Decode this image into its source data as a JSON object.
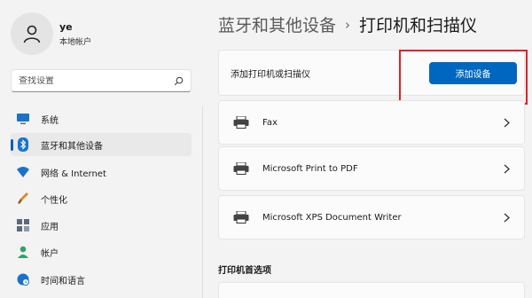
{
  "user": {
    "name": "ye",
    "account_type": "本地帐户"
  },
  "search": {
    "placeholder": "查找设置"
  },
  "sidebar": {
    "items": [
      {
        "label": "系统",
        "icon": "monitor-icon"
      },
      {
        "label": "蓝牙和其他设备",
        "icon": "bluetooth-icon",
        "active": true
      },
      {
        "label": "网络 & Internet",
        "icon": "wifi-icon"
      },
      {
        "label": "个性化",
        "icon": "brush-icon"
      },
      {
        "label": "应用",
        "icon": "apps-icon"
      },
      {
        "label": "帐户",
        "icon": "person-icon"
      },
      {
        "label": "时间和语言",
        "icon": "globe-clock-icon"
      }
    ]
  },
  "breadcrumb": {
    "parent": "蓝牙和其他设备",
    "separator": "›",
    "current": "打印机和扫描仪"
  },
  "add_device": {
    "label": "添加打印机或扫描仪",
    "button_label": "添加设备"
  },
  "printers": [
    {
      "name": "Fax",
      "icon": "printer-icon"
    },
    {
      "name": "Microsoft Print to PDF",
      "icon": "printer-icon"
    },
    {
      "name": "Microsoft XPS Document Writer",
      "icon": "printer-icon"
    }
  ],
  "preferences": {
    "section_title": "打印机首选项"
  },
  "colors": {
    "accent": "#0067c0",
    "highlight": "#e0202a",
    "background": "#f3f3f3"
  }
}
